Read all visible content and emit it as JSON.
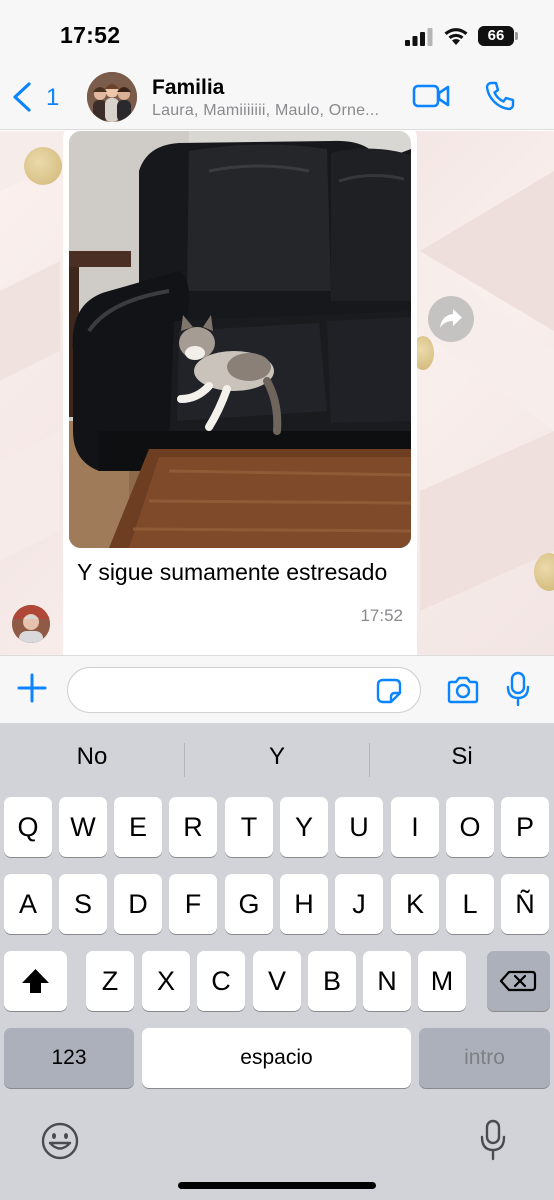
{
  "status_bar": {
    "time": "17:52",
    "battery": "66"
  },
  "header": {
    "back_count": "1",
    "title": "Familia",
    "subtitle": "Laura, Mamiiiiiii, Maulo, Orne..."
  },
  "message": {
    "caption": "Y sigue sumamente estresado",
    "time": "17:52"
  },
  "input": {
    "value": "",
    "placeholder": ""
  },
  "keyboard": {
    "suggestions": [
      "No",
      "Y",
      "Si"
    ],
    "row1": [
      "Q",
      "W",
      "E",
      "R",
      "T",
      "Y",
      "U",
      "I",
      "O",
      "P"
    ],
    "row2": [
      "A",
      "S",
      "D",
      "F",
      "G",
      "H",
      "J",
      "K",
      "L",
      "Ñ"
    ],
    "row3": [
      "Z",
      "X",
      "C",
      "V",
      "B",
      "N",
      "M"
    ],
    "numbers_label": "123",
    "space_label": "espacio",
    "return_label": "intro"
  },
  "colors": {
    "accent": "#0a84ff",
    "keyboard_bg": "#d1d3d9",
    "chat_bg": "#f7ebe9"
  },
  "icons": [
    "back-chevron-icon",
    "video-call-icon",
    "phone-icon",
    "forward-icon",
    "plus-icon",
    "sticker-icon",
    "camera-icon",
    "microphone-icon",
    "shift-icon",
    "backspace-icon",
    "emoji-icon",
    "dictation-icon"
  ]
}
